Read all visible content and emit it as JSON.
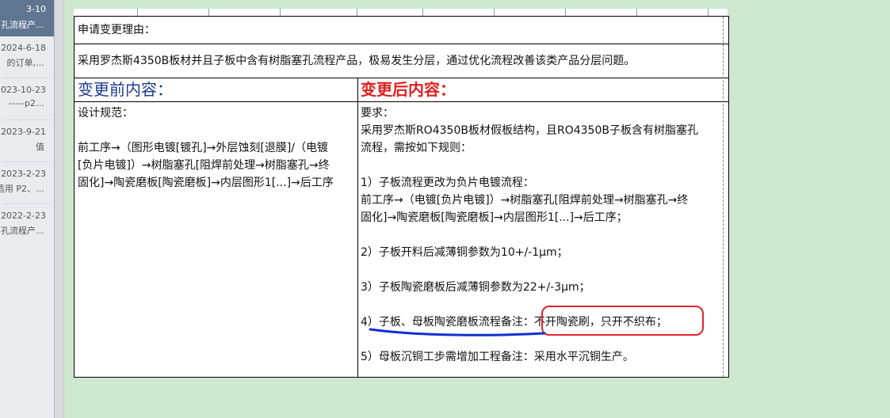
{
  "history": [
    {
      "date": "3-10",
      "title": "孔流程产…",
      "active": true
    },
    {
      "date": "2024-6-18",
      "title": "的订单,…",
      "active": false
    },
    {
      "date": "2023-10-23",
      "title": "-----p2…",
      "active": false
    },
    {
      "date": "2023-9-21",
      "title": "值",
      "active": false
    },
    {
      "date": "2023-2-23",
      "title": "适用 P2、…",
      "active": false
    },
    {
      "date": "2022-2-23",
      "title": "孔流程产…",
      "active": false
    }
  ],
  "form": {
    "reason_label": "申请变更理由：",
    "reason_text": "采用罗杰斯4350B板材并且子板中含有树脂塞孔流程产品，极易发生分层，通过优化流程改善该类产品分层问题。",
    "before_header": "变更前内容：",
    "after_header": "变更后内容：",
    "before": {
      "line1": "设计规范：",
      "line2": "前工序→（图形电镀[镀孔]→外层蚀刻[退膜]/（电镀",
      "line3": "[负片电镀]）→树脂塞孔[阻焊前处理→树脂塞孔→终",
      "line4": "固化]→陶瓷磨板[陶瓷磨板]→内层图形1[...]→后工序"
    },
    "after": {
      "line1": "要求：",
      "line2": "采用罗杰斯RO4350B板材假板结构，且RO4350B子板含有树脂塞孔",
      "line3": "流程，需按如下规则：",
      "rule1_title": "1）子板流程更改为负片电镀流程：",
      "rule1_l1": "前工序→（电镀[负片电镀]）→树脂塞孔[阻焊前处理→树脂塞孔→终",
      "rule1_l2": "固化]→陶瓷磨板[陶瓷磨板]→内层图形1[...]→后工序；",
      "rule2": "2）子板开料后减薄铜参数为10+/-1μm；",
      "rule3": "3）子板陶瓷磨板后减薄铜参数为22+/-3μm；",
      "rule4_a": "4）子板、母板陶瓷磨板流程备注：",
      "rule4_b": "不开陶瓷刷，只开不织布；",
      "rule5": "5）母板沉铜工步需增加工程备注：采用水平沉铜生产。"
    }
  },
  "colors": {
    "before_header": "#1f3a8f",
    "after_header": "#e02020",
    "annotation_circle": "#e2242b",
    "annotation_underline": "#1030d0"
  }
}
